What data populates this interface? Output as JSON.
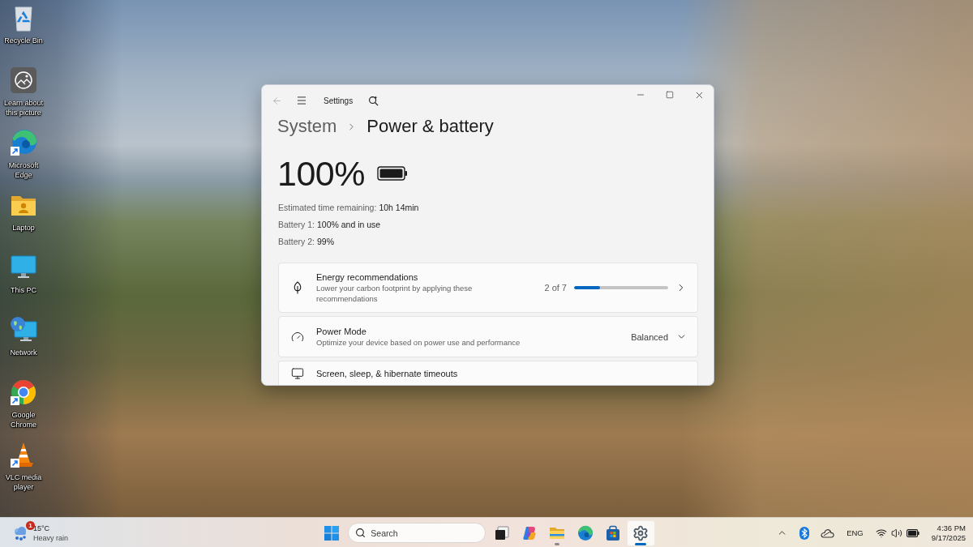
{
  "desktop": {
    "shortcuts": [
      {
        "kind": "recycle",
        "label": "Recycle Bin"
      },
      {
        "kind": "picture",
        "label": "Learn about this picture"
      },
      {
        "kind": "edge",
        "label": "Microsoft Edge"
      },
      {
        "kind": "folder",
        "label": "Laptop"
      },
      {
        "kind": "pc",
        "label": "This PC"
      },
      {
        "kind": "network",
        "label": "Network"
      },
      {
        "kind": "chrome",
        "label": "Google Chrome"
      },
      {
        "kind": "vlc",
        "label": "VLC media player"
      }
    ]
  },
  "settings_window": {
    "title": "Settings",
    "back_disabled": true,
    "breadcrumb": {
      "parent": "System",
      "current": "Power & battery"
    },
    "battery_percent": "100%",
    "details": [
      {
        "label": "Estimated time remaining:",
        "value": "10h 14min"
      },
      {
        "label": "Battery 1:",
        "value": "100% and in use"
      },
      {
        "label": "Battery 2:",
        "value": "99%"
      }
    ],
    "cards": [
      {
        "kind": "progress",
        "title": "Energy recommendations",
        "description": "Lower your carbon footprint by applying these recommendations",
        "count": "2 of 7",
        "level": 0.28
      },
      {
        "kind": "dropdown",
        "title": "Power Mode",
        "description": "Optimize your device based on power use and performance",
        "value": "Balanced"
      },
      {
        "kind": "link",
        "title": "Screen, sleep, & hibernate timeouts"
      }
    ]
  },
  "taskbar": {
    "weather": {
      "badge": "1",
      "temperature": "15°C",
      "condition": "Heavy rain"
    },
    "search": {
      "placeholder": "Search"
    },
    "apps": [
      {
        "kind": "taskview",
        "selected": false,
        "running": false
      },
      {
        "kind": "copilot",
        "selected": false,
        "running": false
      },
      {
        "kind": "explorer",
        "selected": false,
        "running": true
      },
      {
        "kind": "edge",
        "selected": false,
        "running": false
      },
      {
        "kind": "store",
        "selected": false,
        "running": false
      },
      {
        "kind": "settings",
        "selected": true,
        "running": true
      }
    ],
    "tray": {
      "language": "ENG",
      "time": "4:36 PM",
      "date": "9/17/2025"
    }
  }
}
